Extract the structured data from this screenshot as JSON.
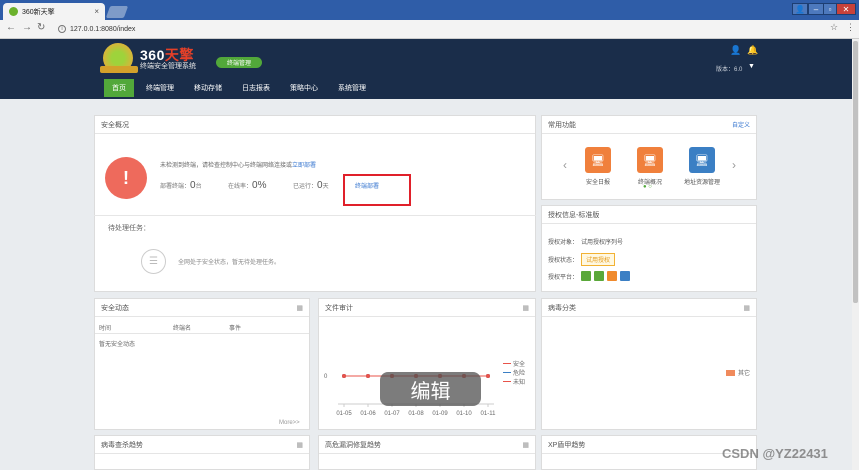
{
  "browser": {
    "tab_title": "360新天擎",
    "url": "127.0.0.1:8080/index",
    "tab_close": "×",
    "star": "☆",
    "menu": "⋮"
  },
  "header": {
    "brand_prefix": "360",
    "brand_suffix": "天擎",
    "brand_sub": "终端安全管理系统",
    "terminal_button": "终端管理",
    "version": "版本：6.0"
  },
  "nav": [
    "首页",
    "终端管理",
    "移动存储",
    "日志报表",
    "策略中心",
    "系统管理"
  ],
  "security": {
    "title": "安全概况",
    "message": "未检测到终端，请检查控制中心与终端网络连接或",
    "message_link": "立即部署",
    "stats": [
      {
        "label": "部署终端：",
        "value": "0",
        "unit": "台"
      },
      {
        "label": "在线率：",
        "value": "0%",
        "unit": ""
      },
      {
        "label": "已运行：",
        "value": "0",
        "unit": "天"
      }
    ],
    "deploy_link": "终端部署",
    "pending_title": "待处理任务：",
    "pending_message": "全网处于安全状态，暂无待处理任务。"
  },
  "common": {
    "title": "常用功能",
    "custom": "自定义",
    "items": [
      {
        "label": "安全日报",
        "color": "#f0803c"
      },
      {
        "label": "终端概况",
        "color": "#f0803c"
      },
      {
        "label": "地址资源管理",
        "color": "#3b7fc4"
      }
    ]
  },
  "license": {
    "title": "授权信息-标准版",
    "target_label": "授权对象：",
    "target_value": "试用授权序列号",
    "status_label": "授权状态：",
    "status_value": "试用授权",
    "platform_label": "授权平台：",
    "platform_colors": [
      "#5aa83a",
      "#5aa83a",
      "#f08a2c",
      "#3b7fc4"
    ]
  },
  "dynamic": {
    "title": "安全动态",
    "columns": [
      "时间",
      "终端名",
      "事件"
    ],
    "empty": "暂无安全动态",
    "more": "More>>"
  },
  "file_audit": {
    "title": "文件审计"
  },
  "virus_class": {
    "title": "病毒分类",
    "legend": "其它"
  },
  "chart_data": {
    "type": "line",
    "x": [
      "01-05",
      "01-06",
      "01-07",
      "01-08",
      "01-09",
      "01-10",
      "01-11"
    ],
    "series": [
      {
        "name": "安全",
        "values": [
          0,
          0,
          0,
          0,
          0,
          0,
          0
        ],
        "color": "#e8534a"
      },
      {
        "name": "危险",
        "values": [
          0,
          0,
          0,
          0,
          0,
          0,
          0
        ],
        "color": "#3b7fc4"
      },
      {
        "name": "未知",
        "values": [
          0,
          0,
          0,
          0,
          0,
          0,
          0
        ],
        "color": "#e8534a"
      }
    ],
    "ytick": "0"
  },
  "bottom_row": [
    "病毒查杀趋势",
    "高危漏洞修复趋势",
    "XP盾甲趋势"
  ],
  "overlay": "编辑",
  "watermark": "CSDN @YZ22431"
}
